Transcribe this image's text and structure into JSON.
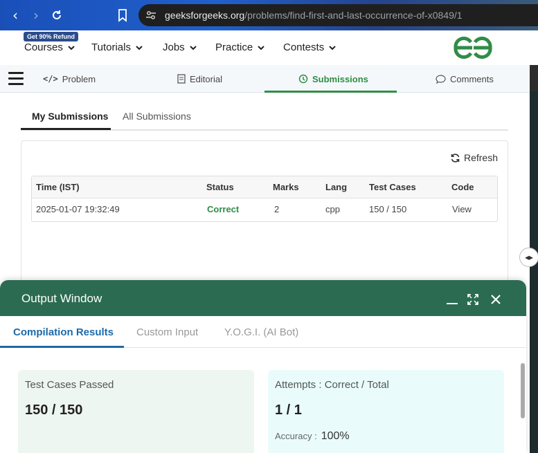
{
  "browser": {
    "url_host": "geeksforgeeks.org",
    "url_path": "/problems/find-first-and-last-occurrence-of-x0849/1"
  },
  "site_nav": {
    "refund_badge": "Get 90% Refund",
    "items": [
      "Courses",
      "Tutorials",
      "Jobs",
      "Practice",
      "Contests"
    ]
  },
  "problem_tabs": {
    "problem": "Problem",
    "editorial": "Editorial",
    "submissions": "Submissions",
    "comments": "Comments"
  },
  "submissions": {
    "tabs": [
      "My Submissions",
      "All Submissions"
    ],
    "refresh_label": "Refresh",
    "columns": [
      "Time (IST)",
      "Status",
      "Marks",
      "Lang",
      "Test Cases",
      "Code"
    ],
    "rows": [
      {
        "time": "2025-01-07 19:32:49",
        "status": "Correct",
        "marks": "2",
        "lang": "cpp",
        "test_cases": "150 / 150",
        "code": "View"
      }
    ]
  },
  "output_window": {
    "title": "Output Window",
    "tabs": [
      "Compilation Results",
      "Custom Input",
      "Y.O.G.I. (AI Bot)"
    ],
    "test_cases_label": "Test Cases Passed",
    "test_cases_value": "150 / 150",
    "attempts_label": "Attempts : Correct / Total",
    "attempts_value": "1 / 1",
    "accuracy_label": "Accuracy :",
    "accuracy_value": "100%"
  },
  "colors": {
    "brand_green": "#2f8d46",
    "header_green": "#2b6b52",
    "active_blue": "#1c6aa8"
  }
}
